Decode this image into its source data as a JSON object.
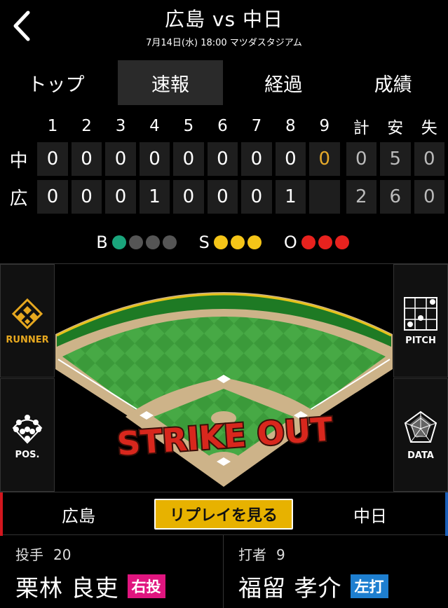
{
  "header": {
    "title": "広島 vs 中日",
    "subtitle": "7月14日(水) 18:00 マツダスタジアム"
  },
  "tabs": [
    {
      "label": "トップ",
      "active": false
    },
    {
      "label": "速報",
      "active": true
    },
    {
      "label": "経過",
      "active": false
    },
    {
      "label": "成績",
      "active": false
    }
  ],
  "scoreboard": {
    "columns": [
      "1",
      "2",
      "3",
      "4",
      "5",
      "6",
      "7",
      "8",
      "9",
      "計",
      "安",
      "失"
    ],
    "rows": [
      {
        "team": "中",
        "innings": [
          "0",
          "0",
          "0",
          "0",
          "0",
          "0",
          "0",
          "0",
          "0"
        ],
        "runs": "0",
        "hits": "5",
        "errors": "0"
      },
      {
        "team": "広",
        "innings": [
          "0",
          "0",
          "0",
          "1",
          "0",
          "0",
          "0",
          "1",
          ""
        ],
        "runs": "2",
        "hits": "6",
        "errors": "0"
      }
    ],
    "current_inning_color": "#e5a92a"
  },
  "count": {
    "balls_label": "B",
    "balls": 1,
    "balls_max": 4,
    "ball_color": "#1aa57c",
    "strikes_label": "S",
    "strikes": 3,
    "strikes_max": 3,
    "strike_color": "#f5c518",
    "outs_label": "O",
    "outs": 3,
    "outs_max": 3,
    "out_color": "#e8221e",
    "empty_color": "#555555"
  },
  "side_buttons": {
    "runner": "RUNNER",
    "pitch": "PITCH",
    "pos": "POS.",
    "data": "DATA"
  },
  "field": {
    "result_text": "STRIKE OUT"
  },
  "replay_bar": {
    "home_team": "広島",
    "replay_label": "リプレイを見る",
    "away_team": "中日"
  },
  "pitcher": {
    "role": "投手",
    "number": "20",
    "name": "栗林 良吏",
    "hand": "右投",
    "hand_color": "#e0157f"
  },
  "batter": {
    "role": "打者",
    "number": "9",
    "name": "福留 孝介",
    "hand": "左打",
    "hand_color": "#1e7fd0"
  }
}
